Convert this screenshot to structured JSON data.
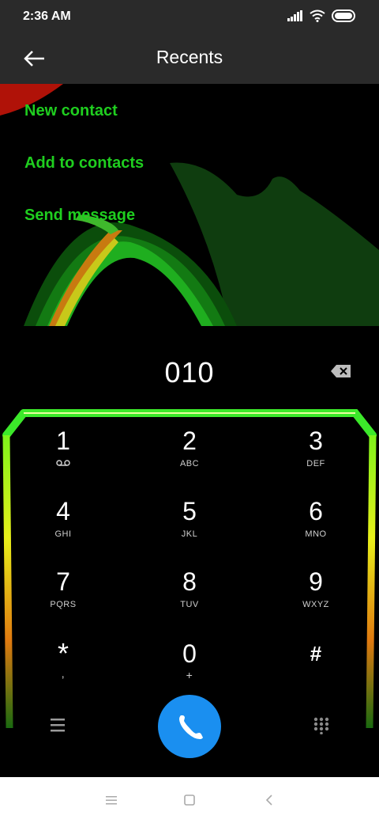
{
  "status": {
    "time": "2:36 AM"
  },
  "header": {
    "title": "Recents"
  },
  "actions": [
    {
      "label": "New contact"
    },
    {
      "label": "Add to contacts"
    },
    {
      "label": "Send message"
    }
  ],
  "dialer": {
    "number": "010"
  },
  "keys": [
    {
      "digit": "1",
      "letters": ""
    },
    {
      "digit": "2",
      "letters": "ABC"
    },
    {
      "digit": "3",
      "letters": "DEF"
    },
    {
      "digit": "4",
      "letters": "GHI"
    },
    {
      "digit": "5",
      "letters": "JKL"
    },
    {
      "digit": "6",
      "letters": "MNO"
    },
    {
      "digit": "7",
      "letters": "PQRS"
    },
    {
      "digit": "8",
      "letters": "TUV"
    },
    {
      "digit": "9",
      "letters": "WXYZ"
    },
    {
      "digit": "*",
      "letters": ","
    },
    {
      "digit": "0",
      "letters": "+"
    },
    {
      "digit": "#",
      "letters": ""
    }
  ],
  "icons": {
    "back": "back-arrow-icon",
    "backspace": "backspace-icon",
    "voicemail": "voicemail-icon",
    "menu": "menu-icon",
    "call": "phone-icon",
    "dialpad": "dialpad-icon"
  },
  "colors": {
    "accent_green": "#1fce1f",
    "call_button": "#1a8ff0"
  }
}
